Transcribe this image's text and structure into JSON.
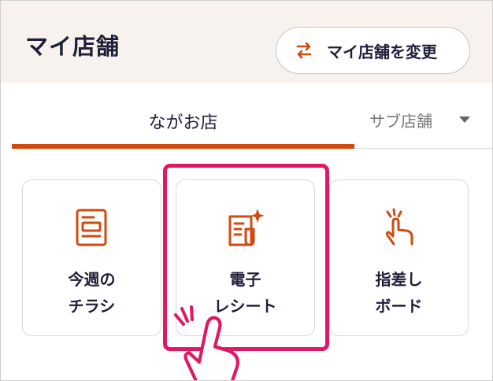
{
  "header": {
    "title": "マイ店舗",
    "change_store_label": "マイ店舗を変更",
    "change_icon": "swap-arrows-icon"
  },
  "tabs": {
    "main_label": "ながお店",
    "sub_label": "サブ店舗",
    "sub_caret_icon": "caret-down-icon"
  },
  "cards": [
    {
      "line1": "今週の",
      "line2": "チラシ",
      "icon": "flyer-icon"
    },
    {
      "line1": "電子",
      "line2": "レシート",
      "icon": "e-receipt-icon"
    },
    {
      "line1": "指差し",
      "line2": "ボード",
      "icon": "pointing-finger-icon"
    }
  ],
  "colors": {
    "accent": "#d14a0f",
    "highlight": "#e01864",
    "header_bg": "#f7f2ee",
    "text": "#1f1f3a"
  },
  "overlay": {
    "highlighted_card": "電子レシート",
    "pointer_icon": "tap-hand-icon"
  }
}
